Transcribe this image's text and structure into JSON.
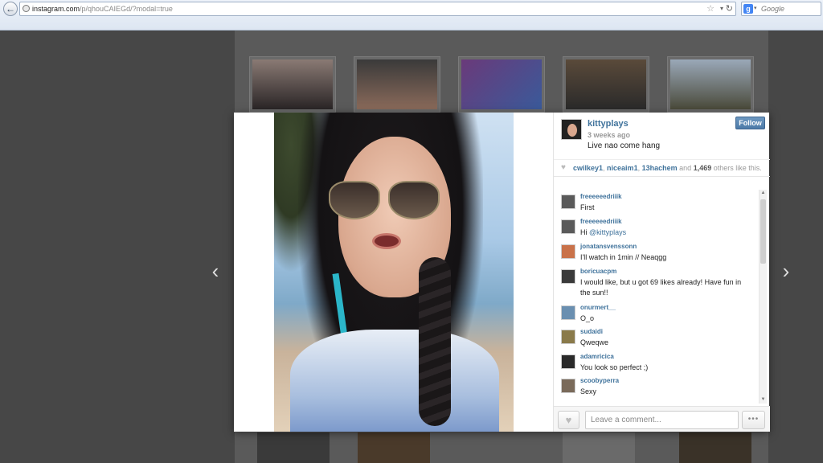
{
  "browser": {
    "url_host": "instagram.com",
    "url_path": "/p/qhouCAIEGd/?modal=true",
    "search_engine": "g-icon",
    "search_placeholder": "Google"
  },
  "post": {
    "username": "kittyplays",
    "time_ago": "3 weeks ago",
    "caption": "Live nao come hang",
    "follow_label": "Follow"
  },
  "likes": {
    "users": [
      "cwilkey1",
      "niceaim1",
      "13hachem"
    ],
    "and_text": "and",
    "count": "1,469",
    "suffix": "others like this."
  },
  "comments": [
    {
      "user": "freeeeeedriiik",
      "text": "First",
      "avatar_color": "#5a5a5a"
    },
    {
      "user": "freeeeeedriiik",
      "text": "Hi ",
      "mention": "@kittyplays",
      "avatar_color": "#5a5a5a"
    },
    {
      "user": "jonatansvenssonn",
      "text": "I'll watch in 1min // Neaqgg",
      "avatar_color": "#c9724a"
    },
    {
      "user": "boricuacpm",
      "text": "I would like, but u got 69 likes already! Have fun in the sun!!",
      "avatar_color": "#3a3a3a"
    },
    {
      "user": "onurmert__",
      "text": "O_o",
      "avatar_color": "#6a8fb0"
    },
    {
      "user": "sudaidi",
      "text": "Qweqwe",
      "avatar_color": "#8a7a4a"
    },
    {
      "user": "adamricica",
      "text": "You look so perfect ;)",
      "avatar_color": "#2a2a2a"
    },
    {
      "user": "scoobyperra",
      "text": "Sexy",
      "avatar_color": "#7a6a5a"
    }
  ],
  "comment_box": {
    "placeholder": "Leave a comment...",
    "more_label": "•••"
  },
  "nav": {
    "prev_icon": "chevron-left-icon",
    "next_icon": "chevron-right-icon"
  },
  "colors": {
    "link": "#3f729b",
    "follow": "#4c7aa8"
  }
}
